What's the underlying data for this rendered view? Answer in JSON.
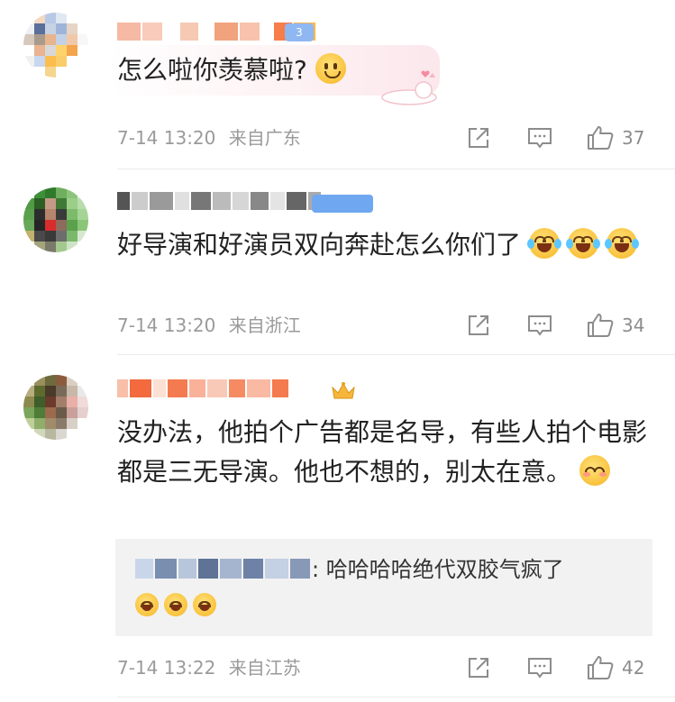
{
  "comments": [
    {
      "text": "怎么啦你羡慕啦?",
      "emoji": [
        "smile-icon"
      ],
      "time": "7-14 13:20",
      "location": "来自广东",
      "likes": "37",
      "badge": "3"
    },
    {
      "text": "好导演和好演员双向奔赴怎么你们了",
      "emoji": [
        "laugh-cry-icon",
        "laugh-cry-icon",
        "laugh-cry-icon"
      ],
      "time": "7-14 13:20",
      "location": "来自浙江",
      "likes": "34"
    },
    {
      "text": "没办法，他拍个广告都是名导，有些人拍个电影都是三无导演。他也不想的，别太在意。",
      "emoji": [
        "shy-icon"
      ],
      "time": "7-14 13:22",
      "location": "来自江苏",
      "likes": "42",
      "reply": {
        "text": ": 哈哈哈哈绝代双胶气疯了",
        "emoji": [
          "giggle-icon",
          "giggle-icon",
          "giggle-icon"
        ]
      }
    }
  ],
  "colors": {
    "meta_gray": "#9a9a9a",
    "divider": "#ececec",
    "quote_bg": "#f2f2f2",
    "badge_blue": "#6fa8f0"
  }
}
